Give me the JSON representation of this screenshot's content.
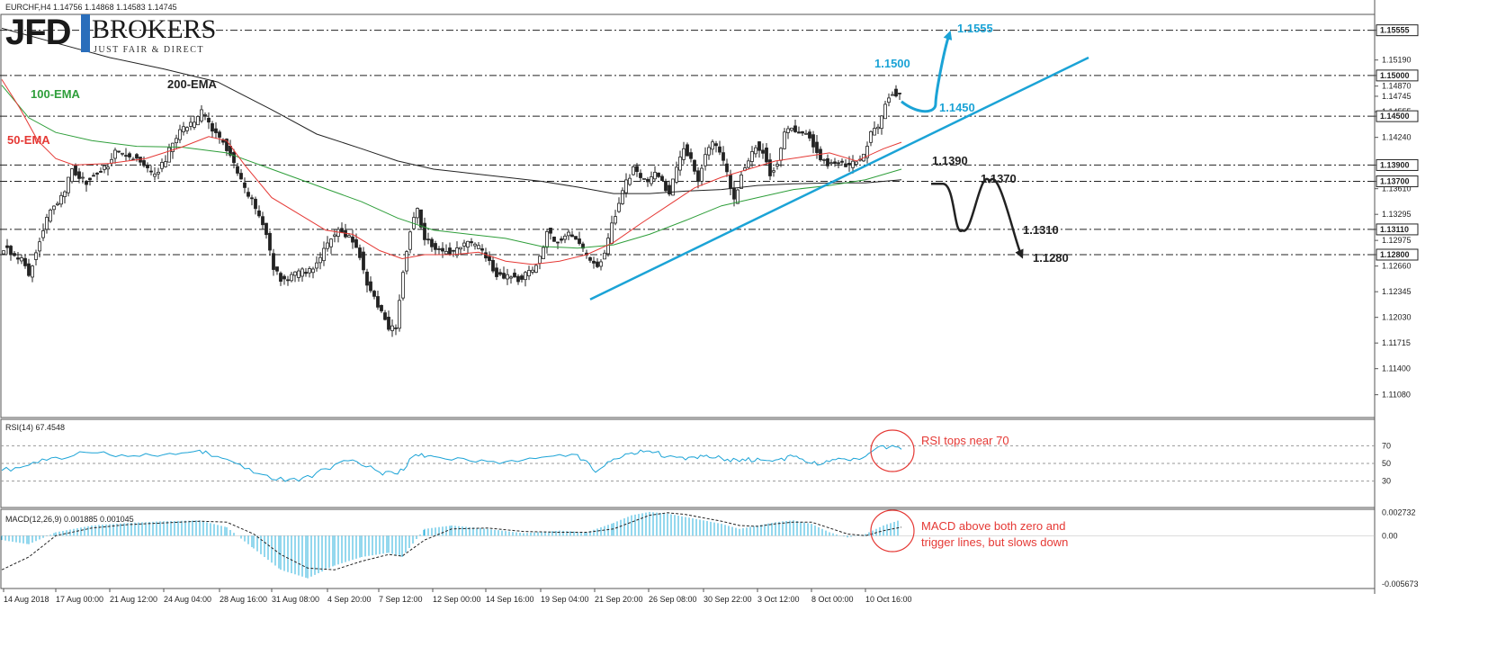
{
  "header": {
    "symbol_line": "EURCHF,H4  1.14756 1.14868 1.14583 1.14745"
  },
  "logo": {
    "brand": "JFD",
    "name": "BROKERS",
    "tagline": "JUST FAIR & DIRECT",
    "accent_color": "#2a6ebb"
  },
  "colors": {
    "candle": "#222222",
    "ema50": "#e53935",
    "ema100": "#2e9e3a",
    "ema200": "#222222",
    "trend": "#1ba3d6",
    "annot_red": "#e53935",
    "rsi": "#1ba3d6",
    "macd_hist": "#2ab0dc"
  },
  "chart_data": [
    {
      "type": "candlestick",
      "panel": "price",
      "title": "EURCHF,H4",
      "ohlc_current": {
        "open": 1.14756,
        "high": 1.14868,
        "low": 1.14583,
        "close": 1.14745
      },
      "ylim": [
        1.108,
        1.1575
      ],
      "y_ticks": [
        "1.15555",
        "1.15190",
        "1.15000",
        "1.14870",
        "1.14745",
        "1.14555",
        "1.14500",
        "1.14240",
        "1.13900",
        "1.13700",
        "1.13610",
        "1.13295",
        "1.13110",
        "1.12975",
        "1.12800",
        "1.12660",
        "1.12345",
        "1.12030",
        "1.11715",
        "1.11400",
        "1.11080"
      ],
      "x_ticks": [
        "14 Aug 2018",
        "17 Aug 00:00",
        "21 Aug 12:00",
        "24 Aug 04:00",
        "28 Aug 16:00",
        "31 Aug 08:00",
        "4 Sep 20:00",
        "7 Sep 12:00",
        "12 Sep 00:00",
        "14 Sep 16:00",
        "19 Sep 04:00",
        "21 Sep 20:00",
        "26 Sep 08:00",
        "30 Sep 22:00",
        "3 Oct 12:00",
        "8 Oct 00:00",
        "10 Oct 16:00"
      ],
      "levels": [
        {
          "value": 1.15555,
          "label": "1.1555"
        },
        {
          "value": 1.15,
          "label": "1.1500"
        },
        {
          "value": 1.145,
          "label": "1.1450"
        },
        {
          "value": 1.139,
          "label": "1.1390"
        },
        {
          "value": 1.137,
          "label": "1.1370"
        },
        {
          "value": 1.1311,
          "label": "1.1310"
        },
        {
          "value": 1.128,
          "label": "1.1280"
        }
      ],
      "series": [
        {
          "name": "50-EMA"
        },
        {
          "name": "100-EMA"
        },
        {
          "name": "200-EMA"
        }
      ],
      "path": [
        [
          0,
          1.1285
        ],
        [
          8,
          1.129
        ],
        [
          16,
          1.1275
        ],
        [
          24,
          1.1275
        ],
        [
          32,
          1.1255
        ],
        [
          40,
          1.1285
        ],
        [
          48,
          1.131
        ],
        [
          56,
          1.1335
        ],
        [
          64,
          1.1345
        ],
        [
          72,
          1.136
        ],
        [
          80,
          1.1385
        ],
        [
          88,
          1.1375
        ],
        [
          96,
          1.137
        ],
        [
          104,
          1.1378
        ],
        [
          112,
          1.1385
        ],
        [
          120,
          1.139
        ],
        [
          128,
          1.141
        ],
        [
          136,
          1.1405
        ],
        [
          144,
          1.1398
        ],
        [
          152,
          1.1402
        ],
        [
          160,
          1.1392
        ],
        [
          168,
          1.138
        ],
        [
          176,
          1.1385
        ],
        [
          184,
          1.1395
        ],
        [
          192,
          1.142
        ],
        [
          200,
          1.143
        ],
        [
          208,
          1.144
        ],
        [
          216,
          1.144
        ],
        [
          224,
          1.1455
        ],
        [
          232,
          1.1442
        ],
        [
          240,
          1.1428
        ],
        [
          248,
          1.142
        ],
        [
          256,
          1.1402
        ],
        [
          264,
          1.138
        ],
        [
          272,
          1.136
        ],
        [
          280,
          1.1345
        ],
        [
          288,
          1.1325
        ],
        [
          296,
          1.1305
        ],
        [
          304,
          1.1265
        ],
        [
          312,
          1.125
        ],
        [
          320,
          1.125
        ],
        [
          328,
          1.1255
        ],
        [
          336,
          1.126
        ],
        [
          344,
          1.126
        ],
        [
          352,
          1.1268
        ],
        [
          360,
          1.1285
        ],
        [
          368,
          1.13
        ],
        [
          376,
          1.131
        ],
        [
          384,
          1.1305
        ],
        [
          392,
          1.1295
        ],
        [
          400,
          1.128
        ],
        [
          408,
          1.1245
        ],
        [
          416,
          1.1225
        ],
        [
          424,
          1.121
        ],
        [
          432,
          1.119
        ],
        [
          440,
          1.119
        ],
        [
          448,
          1.126
        ],
        [
          456,
          1.131
        ],
        [
          464,
          1.1335
        ],
        [
          472,
          1.13
        ],
        [
          480,
          1.129
        ],
        [
          488,
          1.1285
        ],
        [
          496,
          1.1285
        ],
        [
          504,
          1.1282
        ],
        [
          512,
          1.129
        ],
        [
          520,
          1.1295
        ],
        [
          528,
          1.129
        ],
        [
          536,
          1.1285
        ],
        [
          544,
          1.127
        ],
        [
          552,
          1.1255
        ],
        [
          560,
          1.1252
        ],
        [
          568,
          1.1255
        ],
        [
          576,
          1.125
        ],
        [
          584,
          1.1255
        ],
        [
          592,
          1.126
        ],
        [
          600,
          1.1275
        ],
        [
          608,
          1.131
        ],
        [
          616,
          1.1295
        ],
        [
          624,
          1.13
        ],
        [
          632,
          1.1305
        ],
        [
          640,
          1.1298
        ],
        [
          648,
          1.1285
        ],
        [
          656,
          1.127
        ],
        [
          664,
          1.1265
        ],
        [
          672,
          1.128
        ],
        [
          680,
          1.1315
        ],
        [
          688,
          1.1345
        ],
        [
          696,
          1.137
        ],
        [
          704,
          1.1385
        ],
        [
          712,
          1.1375
        ],
        [
          720,
          1.1368
        ],
        [
          728,
          1.1382
        ],
        [
          736,
          1.137
        ],
        [
          744,
          1.1355
        ],
        [
          752,
          1.1385
        ],
        [
          760,
          1.1412
        ],
        [
          768,
          1.1398
        ],
        [
          776,
          1.137
        ],
        [
          784,
          1.1402
        ],
        [
          792,
          1.142
        ],
        [
          800,
          1.1408
        ],
        [
          808,
          1.1378
        ],
        [
          816,
          1.1345
        ],
        [
          824,
          1.138
        ],
        [
          832,
          1.1395
        ],
        [
          840,
          1.1415
        ],
        [
          848,
          1.1408
        ],
        [
          856,
          1.1378
        ],
        [
          864,
          1.1395
        ],
        [
          872,
          1.1428
        ],
        [
          880,
          1.1435
        ],
        [
          888,
          1.1428
        ],
        [
          896,
          1.1432
        ],
        [
          904,
          1.1415
        ],
        [
          912,
          1.1398
        ],
        [
          920,
          1.1392
        ],
        [
          928,
          1.1395
        ],
        [
          936,
          1.1392
        ],
        [
          944,
          1.1388
        ],
        [
          952,
          1.1395
        ],
        [
          960,
          1.14
        ],
        [
          968,
          1.143
        ],
        [
          976,
          1.1435
        ],
        [
          984,
          1.1465
        ],
        [
          992,
          1.148
        ],
        [
          1000,
          1.1475
        ]
      ],
      "ema50": [
        [
          0,
          1.1495
        ],
        [
          20,
          1.146
        ],
        [
          40,
          1.142
        ],
        [
          60,
          1.1398
        ],
        [
          80,
          1.139
        ],
        [
          120,
          1.1392
        ],
        [
          160,
          1.1398
        ],
        [
          200,
          1.1412
        ],
        [
          230,
          1.1425
        ],
        [
          250,
          1.142
        ],
        [
          270,
          1.139
        ],
        [
          300,
          1.135
        ],
        [
          330,
          1.133
        ],
        [
          360,
          1.131
        ],
        [
          390,
          1.1305
        ],
        [
          420,
          1.1285
        ],
        [
          445,
          1.1275
        ],
        [
          470,
          1.128
        ],
        [
          500,
          1.128
        ],
        [
          530,
          1.1283
        ],
        [
          560,
          1.1272
        ],
        [
          590,
          1.1268
        ],
        [
          620,
          1.1272
        ],
        [
          650,
          1.128
        ],
        [
          680,
          1.1295
        ],
        [
          710,
          1.1318
        ],
        [
          740,
          1.134
        ],
        [
          770,
          1.1362
        ],
        [
          800,
          1.1375
        ],
        [
          830,
          1.1385
        ],
        [
          860,
          1.1395
        ],
        [
          890,
          1.14
        ],
        [
          920,
          1.1405
        ],
        [
          950,
          1.1395
        ],
        [
          980,
          1.141
        ],
        [
          1000,
          1.1418
        ]
      ],
      "ema100": [
        [
          0,
          1.1488
        ],
        [
          30,
          1.1448
        ],
        [
          60,
          1.143
        ],
        [
          100,
          1.142
        ],
        [
          150,
          1.1413
        ],
        [
          200,
          1.1412
        ],
        [
          250,
          1.1405
        ],
        [
          300,
          1.1385
        ],
        [
          350,
          1.1365
        ],
        [
          400,
          1.1345
        ],
        [
          440,
          1.1325
        ],
        [
          480,
          1.131
        ],
        [
          520,
          1.1305
        ],
        [
          560,
          1.13
        ],
        [
          600,
          1.129
        ],
        [
          640,
          1.1288
        ],
        [
          680,
          1.1292
        ],
        [
          720,
          1.1305
        ],
        [
          760,
          1.1322
        ],
        [
          800,
          1.134
        ],
        [
          840,
          1.135
        ],
        [
          880,
          1.136
        ],
        [
          920,
          1.1365
        ],
        [
          960,
          1.1372
        ],
        [
          1000,
          1.1385
        ]
      ],
      "ema200": [
        [
          0,
          1.1558
        ],
        [
          60,
          1.154
        ],
        [
          120,
          1.1522
        ],
        [
          180,
          1.1508
        ],
        [
          240,
          1.1492
        ],
        [
          300,
          1.1458
        ],
        [
          350,
          1.1428
        ],
        [
          400,
          1.141
        ],
        [
          440,
          1.1395
        ],
        [
          480,
          1.1385
        ],
        [
          520,
          1.138
        ],
        [
          560,
          1.1375
        ],
        [
          600,
          1.137
        ],
        [
          640,
          1.1363
        ],
        [
          680,
          1.1355
        ],
        [
          720,
          1.1355
        ],
        [
          760,
          1.1358
        ],
        [
          800,
          1.136
        ],
        [
          840,
          1.1365
        ],
        [
          880,
          1.1367
        ],
        [
          920,
          1.1368
        ],
        [
          960,
          1.1368
        ],
        [
          1000,
          1.1372
        ]
      ],
      "trendline": [
        [
          656,
          1.1225
        ],
        [
          1210,
          1.1522
        ]
      ],
      "scenario_up": [
        [
          1002,
          1.1468
        ],
        [
          1020,
          1.1452
        ],
        [
          1040,
          1.1465
        ],
        [
          1055,
          1.155
        ]
      ],
      "scenario_down": [
        [
          1035,
          1.1367
        ],
        [
          1048,
          1.1367
        ],
        [
          1070,
          1.131
        ],
        [
          1100,
          1.137
        ],
        [
          1135,
          1.128
        ]
      ],
      "annotations": [
        {
          "text": "1.1555",
          "value": 1.15555,
          "color": "trend"
        },
        {
          "text": "1.1500",
          "value": 1.15,
          "color": "trend"
        },
        {
          "text": "1.1450",
          "value": 1.145,
          "color": "trend"
        },
        {
          "text": "1.1390",
          "value": 1.139,
          "color": "dark"
        },
        {
          "text": "1.1370",
          "value": 1.137,
          "color": "dark"
        },
        {
          "text": "1.1310",
          "value": 1.1311,
          "color": "dark"
        },
        {
          "text": "1.1280",
          "value": 1.128,
          "color": "dark"
        },
        {
          "text": "50-EMA",
          "value": 1.1425,
          "color": "ema50"
        },
        {
          "text": "100-EMA",
          "value": 1.1487,
          "color": "ema100"
        },
        {
          "text": "200-EMA",
          "value": 1.1523,
          "color": "ema200"
        }
      ]
    },
    {
      "type": "line",
      "panel": "rsi",
      "title": "RSI(14) 67.4548",
      "value": 67.4548,
      "ylim": [
        0,
        100
      ],
      "y_ticks": [
        "70",
        "50",
        "30"
      ],
      "levels": [
        30,
        50,
        70
      ],
      "x": [
        0,
        30,
        60,
        100,
        140,
        180,
        220,
        240,
        270,
        300,
        330,
        360,
        390,
        420,
        440,
        460,
        480,
        520,
        560,
        600,
        640,
        660,
        680,
        700,
        720,
        740,
        760,
        780,
        800,
        820,
        840,
        860,
        880,
        900,
        920,
        940,
        960,
        980,
        1000
      ],
      "values": [
        42,
        48,
        57,
        62,
        58,
        60,
        65,
        58,
        44,
        32,
        30,
        44,
        54,
        40,
        38,
        60,
        58,
        53,
        52,
        57,
        60,
        40,
        55,
        62,
        64,
        58,
        54,
        58,
        56,
        52,
        56,
        54,
        58,
        50,
        52,
        54,
        58,
        70,
        66
      ],
      "annotation": "RSI tops near 70"
    },
    {
      "type": "bar",
      "panel": "macd",
      "title": "MACD(12,26,9) 0.001885 0.001045",
      "values_pair": [
        0.001885,
        0.001045
      ],
      "ylim": [
        -0.0062,
        0.0031
      ],
      "y_ticks": [
        "0.002732",
        "0.00",
        "-0.005673"
      ],
      "x": [
        0,
        30,
        60,
        100,
        140,
        180,
        220,
        250,
        280,
        310,
        340,
        370,
        400,
        430,
        445,
        470,
        500,
        540,
        580,
        620,
        650,
        680,
        700,
        720,
        740,
        760,
        780,
        800,
        820,
        840,
        860,
        880,
        900,
        920,
        940,
        960,
        980,
        1000
      ],
      "histogram": [
        -0.0005,
        -0.001,
        0.0004,
        0.0012,
        0.0015,
        0.0017,
        0.0018,
        0.001,
        -0.0015,
        -0.004,
        -0.005,
        -0.0035,
        -0.0025,
        -0.002,
        -0.0025,
        0.0008,
        0.0012,
        0.0008,
        0.0003,
        0.0006,
        0.0004,
        0.0015,
        0.0024,
        0.0028,
        0.0026,
        0.0022,
        0.0018,
        0.0014,
        0.0008,
        0.0012,
        0.0016,
        0.0018,
        0.0014,
        0.0004,
        -0.0002,
        0.0002,
        0.0012,
        0.0019
      ],
      "signal": [
        -0.004,
        -0.0025,
        0.0,
        0.0009,
        0.0013,
        0.0015,
        0.0017,
        0.0016,
        0.0002,
        -0.0022,
        -0.0038,
        -0.004,
        -0.003,
        -0.0022,
        -0.0024,
        -0.0005,
        0.0008,
        0.0009,
        0.0005,
        0.0004,
        0.0004,
        0.0008,
        0.0016,
        0.0024,
        0.0027,
        0.0025,
        0.0021,
        0.0017,
        0.0012,
        0.0011,
        0.0014,
        0.0016,
        0.0016,
        0.0009,
        0.0002,
        0.0,
        0.0006,
        0.001
      ],
      "annotation": [
        "MACD above both zero and",
        "trigger lines, but slows down"
      ]
    }
  ]
}
